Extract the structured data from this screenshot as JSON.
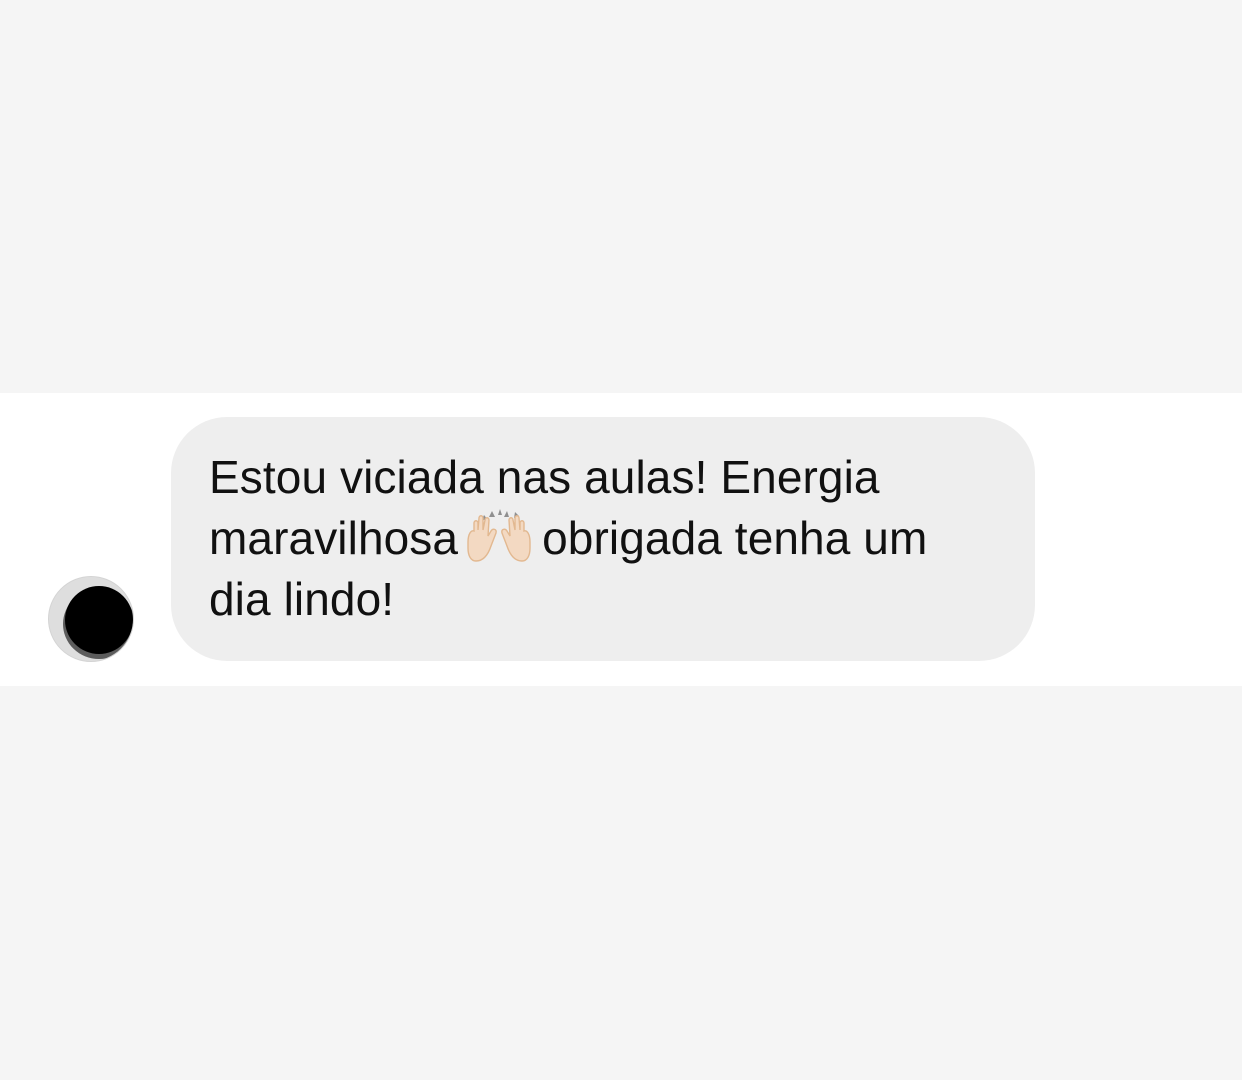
{
  "chat": {
    "message": {
      "line1": "Estou viciada nas aulas! Energia",
      "line2_before_emoji": "maravilhosa",
      "emoji": "raising-hands-emoji",
      "line2_after_emoji": "obrigada tenha um",
      "line3": "dia lindo!"
    },
    "sender_avatar": "avatar-redacted"
  },
  "colors": {
    "page_background": "#f5f5f5",
    "message_strip": "#ffffff",
    "bubble_background": "#eeeeee",
    "text": "#111111",
    "redaction": "#000000"
  }
}
